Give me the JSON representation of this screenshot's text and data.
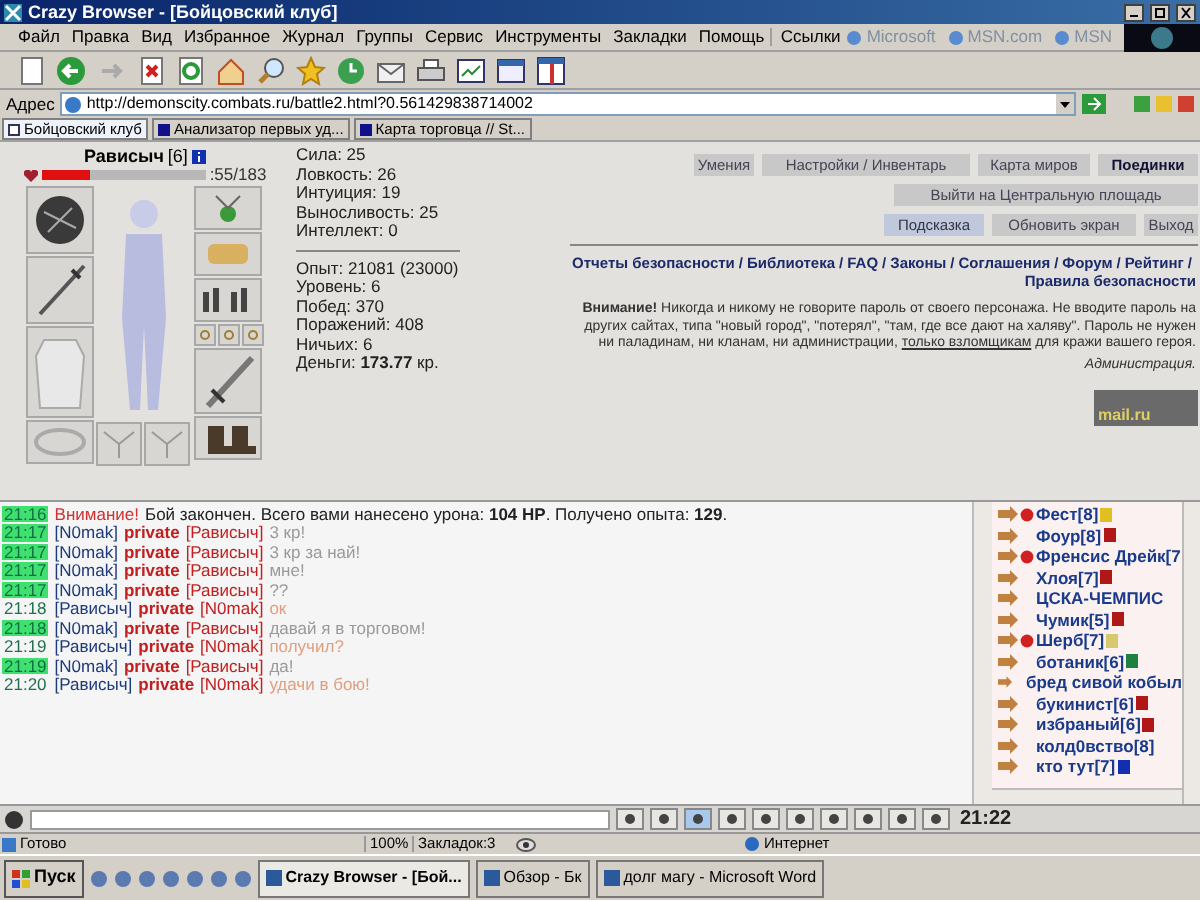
{
  "window": {
    "title": "Crazy Browser - [Бойцовский клуб]"
  },
  "menu": [
    "Файл",
    "Правка",
    "Вид",
    "Избранное",
    "Журнал",
    "Группы",
    "Сервис",
    "Инструменты",
    "Закладки",
    "Помощь"
  ],
  "links_bar": {
    "label": "Ссылки",
    "links": [
      "Microsoft",
      "MSN.com",
      "MSN"
    ]
  },
  "address_bar": {
    "label": "Адрес",
    "value": "http://demonscity.combats.ru/battle2.html?0.561429838714002"
  },
  "tabs": [
    {
      "label": "Бойцовский клуб",
      "selected": true
    },
    {
      "label": "Анализатор первых уд...",
      "selected": false
    },
    {
      "label": "Карта торговца // St...",
      "selected": false
    }
  ],
  "character": {
    "name": "Рависыч",
    "level": "[6]",
    "hp": {
      "level": 0.3,
      "reading": ":55/183"
    }
  },
  "stats": [
    {
      "label": "Сила:",
      "value": "25"
    },
    {
      "label": "Ловкость:",
      "value": "26"
    },
    {
      "label": "Интуиция:",
      "value": "19"
    },
    {
      "label": "Выносливость:",
      "value": "25"
    },
    {
      "label": "Интеллект:",
      "value": "0"
    }
  ],
  "record": [
    {
      "label": "Опыт:",
      "value": "21081 (23000)",
      "bold": false
    },
    {
      "label": "Уровень:",
      "value": "6",
      "bold": false
    },
    {
      "label": "Побед:",
      "value": "370",
      "bold": false
    },
    {
      "label": "Поражений:",
      "value": "408",
      "bold": false
    },
    {
      "label": "Ничьих:",
      "value": "6",
      "bold": false
    },
    {
      "label": "Деньги:",
      "value": "173.77",
      "unit": "кр.",
      "bold": true
    }
  ],
  "buttons": [
    [
      {
        "label": "Умения",
        "kind": "normal"
      },
      {
        "label": "Настройки / Инвентарь",
        "kind": "normal"
      },
      {
        "label": "Карта миров",
        "kind": "normal"
      },
      {
        "label": "Поединки",
        "kind": "bold"
      }
    ],
    [
      {
        "label": "Выйти на Центральную площадь",
        "kind": "normal"
      }
    ],
    [
      {
        "label": "Подсказка",
        "kind": "hint"
      },
      {
        "label": "Обновить экран",
        "kind": "normal"
      },
      {
        "label": "Выход",
        "kind": "normal"
      }
    ]
  ],
  "info_links": {
    "separator": "/",
    "links": [
      "Отчеты безопасности",
      "Библиотека",
      "FAQ",
      "Законы",
      "Соглашения",
      "Форум",
      "Рейтинг",
      "Правила безопасности"
    ]
  },
  "warning": {
    "text": "**Внимание!** Никогда и никому не говорите пароль от своего персонажа. Не вводите пароль на других сайтах, типа \"новый город\", \"потерял\", \"там, где все дают на халяву\". Пароль не нужен ни паладинам, ни кланам, ни администрации,",
    "link": "только взломщикам",
    "text_after": "для кражи вашего героя.",
    "signature": "Администрация."
  },
  "counter": {
    "label": "mail.ru"
  },
  "chat": [
    {
      "time": "21:16",
      "highlighted": true,
      "kind": "system",
      "alert": "Внимание!",
      "text": "Бой закончен. Всего вами нанесено урона: **104 HP**. Получено опыта: **129**."
    },
    {
      "time": "21:17",
      "highlighted": true,
      "kind": "incoming",
      "from": "[N0mak]",
      "tag": "private",
      "to": "[Рависыч]",
      "text": "3 кр!"
    },
    {
      "time": "21:17",
      "highlighted": true,
      "kind": "incoming",
      "from": "[N0mak]",
      "tag": "private",
      "to": "[Рависыч]",
      "text": "3 кр за най!"
    },
    {
      "time": "21:17",
      "highlighted": true,
      "kind": "incoming",
      "from": "[N0mak]",
      "tag": "private",
      "to": "[Рависыч]",
      "text": "мне!"
    },
    {
      "time": "21:17",
      "highlighted": true,
      "kind": "incoming",
      "from": "[N0mak]",
      "tag": "private",
      "to": "[Рависыч]",
      "text": "??"
    },
    {
      "time": "21:18",
      "highlighted": false,
      "kind": "outgoing",
      "from": "[Рависыч]",
      "tag": "private",
      "to": "[N0mak]",
      "text": "ок"
    },
    {
      "time": "21:18",
      "highlighted": true,
      "kind": "incoming",
      "from": "[N0mak]",
      "tag": "private",
      "to": "[Рависыч]",
      "text": "давай я в торговом!"
    },
    {
      "time": "21:19",
      "highlighted": false,
      "kind": "outgoing",
      "from": "[Рависыч]",
      "tag": "private",
      "to": "[N0mak]",
      "text": "получил?"
    },
    {
      "time": "21:19",
      "highlighted": true,
      "kind": "incoming",
      "from": "[N0mak]",
      "tag": "private",
      "to": "[Рависыч]",
      "text": "да!"
    },
    {
      "time": "21:20",
      "highlighted": false,
      "kind": "outgoing",
      "from": "[Рависыч]",
      "tag": "private",
      "to": "[N0mak]",
      "text": "удачи в бою!"
    }
  ],
  "users": [
    {
      "name": "Фест[8]",
      "color": "#e0c020",
      "clan": true
    },
    {
      "name": "Фоур[8]",
      "color": "#b01818",
      "clan": false
    },
    {
      "name": "Френсис Дрейк[7",
      "clan": true
    },
    {
      "name": "Хлоя[7]",
      "color": "#b01818",
      "clan": false
    },
    {
      "name": "ЦСКА-ЧЕМПИС",
      "clan": false
    },
    {
      "name": "Чумик[5]",
      "color": "#b01818",
      "clan": false
    },
    {
      "name": "Шерб[7]",
      "color": "#d8c870",
      "clan": true
    },
    {
      "name": "ботаник[6]",
      "color": "#208040",
      "clan": false
    },
    {
      "name": "бред сивой кобыл",
      "clan": false
    },
    {
      "name": "букинист[6]",
      "color": "#b01818",
      "clan": false
    },
    {
      "name": "избраный[6]",
      "color": "#b01818",
      "clan": false
    },
    {
      "name": "колд0вство[8]",
      "clan": false
    },
    {
      "name": "кто тут[7]",
      "color": "#1030b0",
      "clan": false
    }
  ],
  "chat_clock": "21:22",
  "status_bar": {
    "text": "Готово",
    "zoom": "100%",
    "bookmarks": "Закладок:3",
    "zone": "Интернет"
  },
  "taskbar": {
    "start": "Пуск",
    "tasks": [
      {
        "label": "Crazy Browser - [Бой...",
        "selected": true
      },
      {
        "label": "Обзор - Бк",
        "selected": false
      },
      {
        "label": "долг магу - Microsoft Word",
        "selected": false
      }
    ]
  }
}
